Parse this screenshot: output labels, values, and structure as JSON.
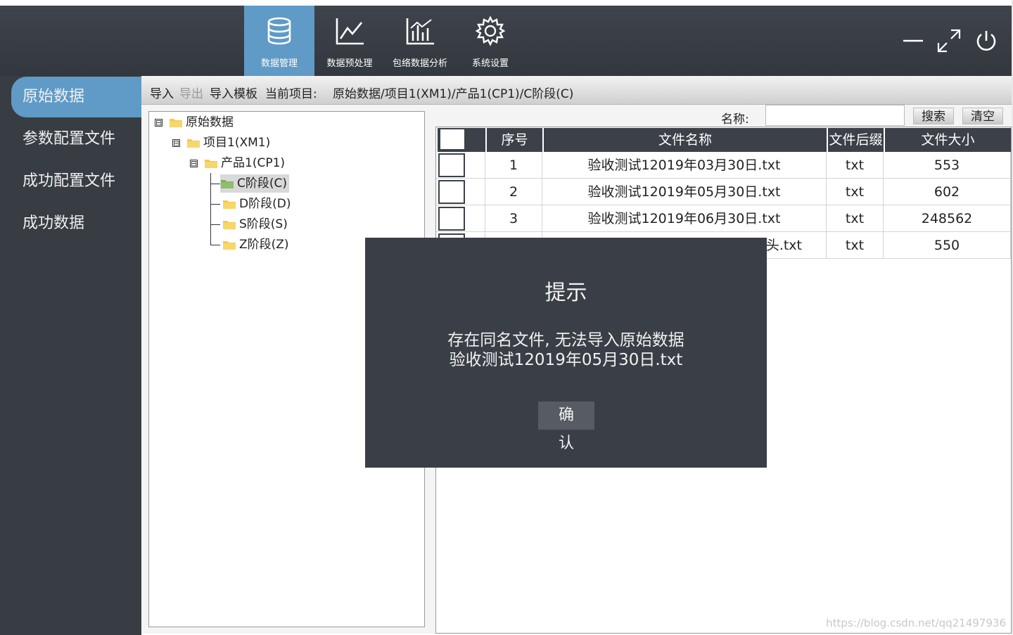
{
  "nav": {
    "items": [
      {
        "label": "数据管理",
        "icon": "database-icon",
        "active": true
      },
      {
        "label": "数据预处理",
        "icon": "line-chart-icon",
        "active": false
      },
      {
        "label": "包络数据分析",
        "icon": "bar-chart-icon",
        "active": false
      },
      {
        "label": "系统设置",
        "icon": "gear-icon",
        "active": false
      }
    ]
  },
  "window_controls": [
    "minimize-icon",
    "maximize-icon",
    "power-icon"
  ],
  "sidebar": {
    "items": [
      {
        "label": "原始数据",
        "active": true
      },
      {
        "label": "参数配置文件",
        "active": false
      },
      {
        "label": "成功配置文件",
        "active": false
      },
      {
        "label": "成功数据",
        "active": false
      }
    ]
  },
  "toolbar": {
    "import_label": "导入",
    "export_label": "导出",
    "template_label": "导入模板",
    "current_label": "当前项目:",
    "current_path": "原始数据/项目1(XM1)/产品1(CP1)/C阶段(C)"
  },
  "tree": {
    "root": "原始数据",
    "project": "项目1(XM1)",
    "product": "产品1(CP1)",
    "stages": [
      "C阶段(C)",
      "D阶段(D)",
      "S阶段(S)",
      "Z阶段(Z)"
    ],
    "expander_glyph": "⊟"
  },
  "search": {
    "label": "名称:",
    "value": "",
    "search_button": "搜索",
    "clear_button": "清空"
  },
  "table": {
    "columns": [
      "序号",
      "文件名称",
      "文件后缀",
      "文件大小"
    ],
    "rows": [
      {
        "index": "1",
        "name": "验收测试12019年03月30日.txt",
        "suffix": "txt",
        "size": "553"
      },
      {
        "index": "2",
        "name": "验收测试12019年05月30日.txt",
        "suffix": "txt",
        "size": "602"
      },
      {
        "index": "3",
        "name": "验收测试12019年06月30日.txt",
        "suffix": "txt",
        "size": "248562"
      },
      {
        "index": "",
        "name": "则头.txt",
        "suffix": "txt",
        "size": "550"
      }
    ]
  },
  "dialog": {
    "title": "提示",
    "message_line1": "存在同名文件, 无法导入原始数据",
    "message_line2": "验收测试12019年05月30日.txt",
    "confirm_button": "确 认"
  },
  "watermark": "https://blog.csdn.net/qq21497936",
  "colors": {
    "header_bg": "#3a3e46",
    "accent": "#5f9bc6",
    "sidebar_bg": "#383c43",
    "folder": "#f2c94c",
    "folder_selected": "#8fbf6a"
  }
}
